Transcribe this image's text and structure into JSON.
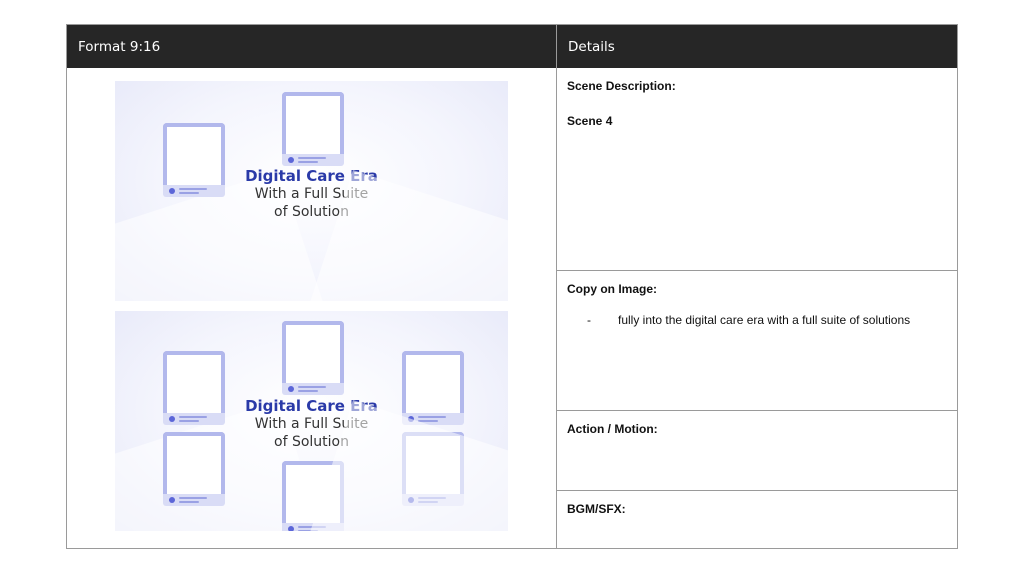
{
  "table": {
    "header_left": "Format 9:16",
    "header_right": "Details"
  },
  "frames": [
    {
      "title_line1": "Digital Care Era",
      "title_line2": "With a Full Suite",
      "title_line3": "of Solution"
    },
    {
      "title_line1": "Digital Care Era",
      "title_line2": "With a Full Suite",
      "title_line3": "of Solution"
    }
  ],
  "details": {
    "scene_description_label": "Scene Description:",
    "scene_value": "Scene 4",
    "copy_label": "Copy on Image:",
    "copy_bullet_marker": "-",
    "copy_bullet_text": "fully into the digital care era with a full suite of solutions",
    "action_label": "Action / Motion:",
    "bgm_label": "BGM/SFX:"
  },
  "colors": {
    "header_bg": "#262626",
    "title_blue": "#2a3aa8",
    "device_outline": "#b2b8ec"
  }
}
